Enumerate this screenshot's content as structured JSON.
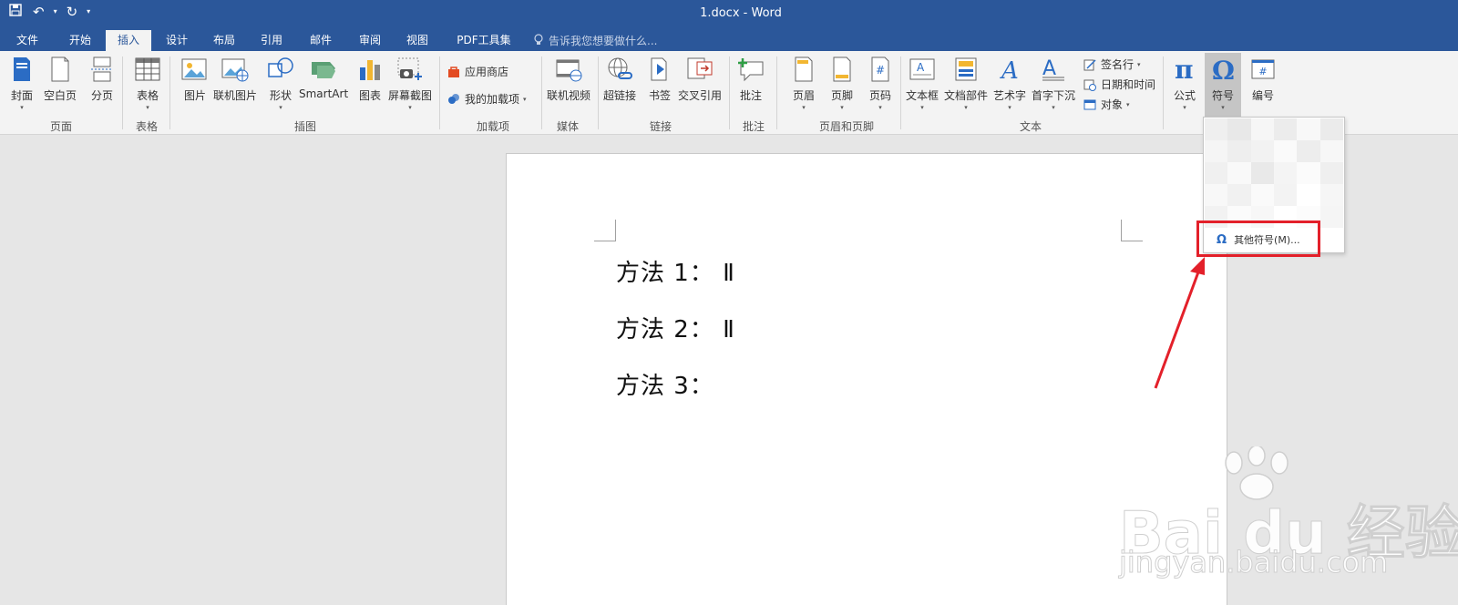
{
  "titlebar": {
    "title": "1.docx - Word",
    "qat": {
      "save": "save-icon",
      "undo": "undo-icon",
      "redo": "redo-icon",
      "customize": "customize-icon"
    }
  },
  "tabs": [
    "文件",
    "开始",
    "插入",
    "设计",
    "布局",
    "引用",
    "邮件",
    "审阅",
    "视图",
    "PDF工具集"
  ],
  "active_tab": "插入",
  "tellme": "告诉我您想要做什么...",
  "ribbon": {
    "pages": {
      "cover": "封面",
      "blank": "空白页",
      "break": "分页",
      "group": "页面"
    },
    "tables": {
      "table": "表格",
      "group": "表格"
    },
    "illustrations": {
      "picture": "图片",
      "online_picture": "联机图片",
      "shapes": "形状",
      "smartart": "SmartArt",
      "chart": "图表",
      "screenshot": "屏幕截图",
      "group": "插图"
    },
    "addins": {
      "store": "应用商店",
      "my_addins": "我的加载项",
      "group": "加载项"
    },
    "media": {
      "online_video": "联机视频",
      "group": "媒体"
    },
    "links": {
      "hyperlink": "超链接",
      "bookmark": "书签",
      "cross_ref": "交叉引用",
      "group": "链接"
    },
    "comments": {
      "comment": "批注",
      "group": "批注"
    },
    "header_footer": {
      "header": "页眉",
      "footer": "页脚",
      "page_number": "页码",
      "group": "页眉和页脚"
    },
    "text": {
      "textbox": "文本框",
      "quick_parts": "文档部件",
      "wordart": "艺术字",
      "dropcap": "首字下沉",
      "signature": "签名行",
      "datetime": "日期和时间",
      "object": "对象",
      "group": "文本"
    },
    "symbols": {
      "equation": "公式",
      "symbol": "符号",
      "numbering": "编号"
    }
  },
  "document": {
    "lines": [
      "方法 1： Ⅱ",
      "方法 2： Ⅱ",
      "方法 3："
    ]
  },
  "symbol_dropdown": {
    "more_symbols": "其他符号(M)...",
    "highlight_color": "#e3202a"
  },
  "watermark": {
    "logo": "Bai du 经验",
    "url": "jingyan.baidu.com"
  },
  "colors": {
    "accent": "#2b579a",
    "annotation": "#e3202a"
  }
}
